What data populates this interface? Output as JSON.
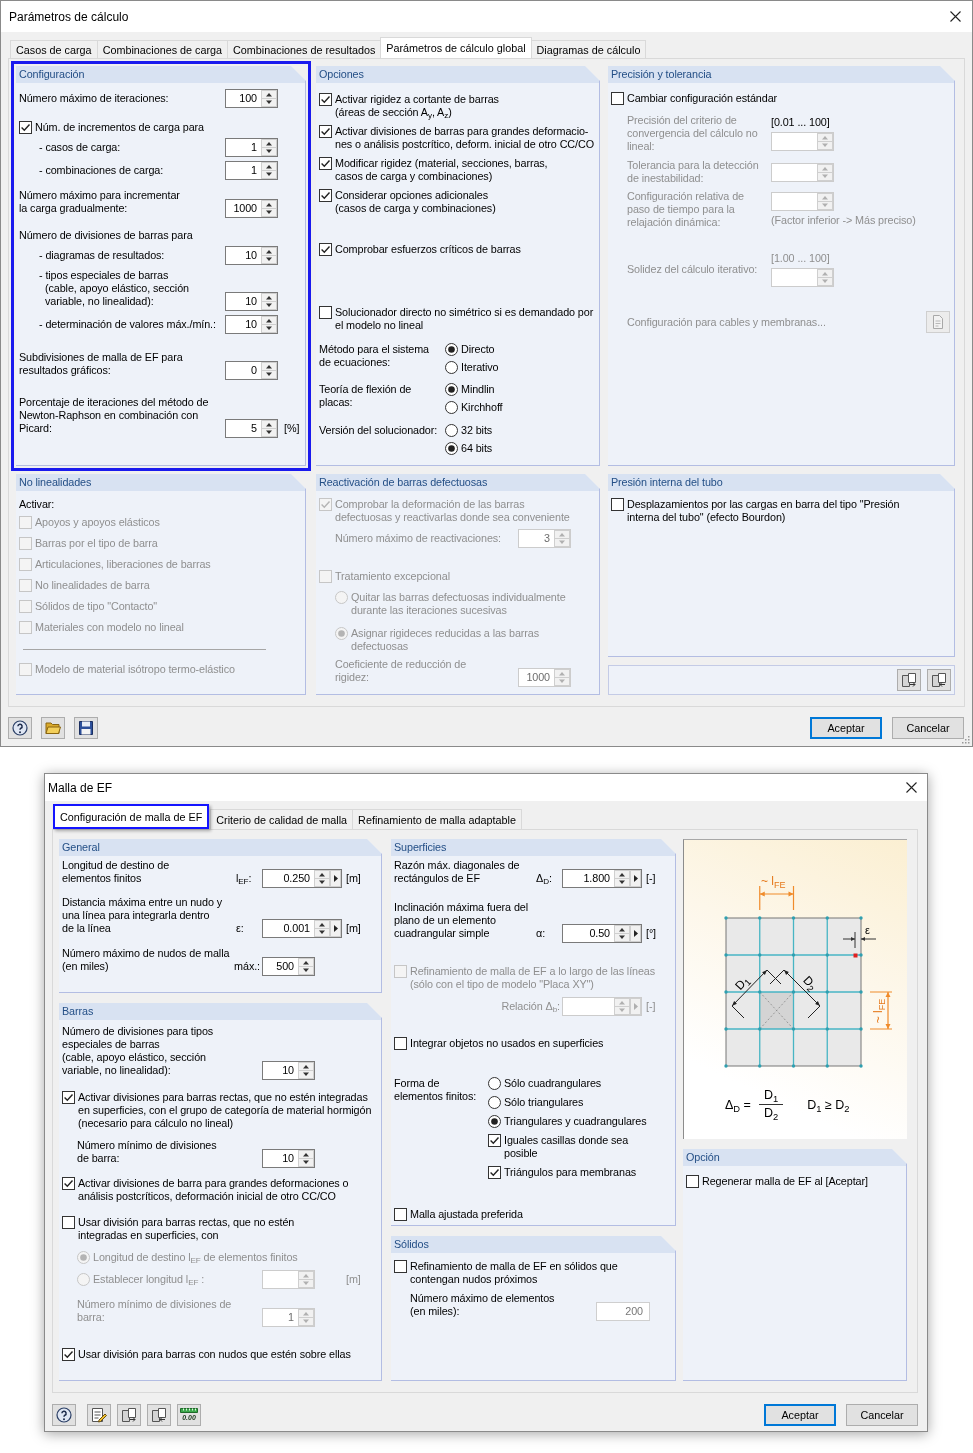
{
  "dialogs": [
    {
      "title": "Parámetros de cálculo",
      "tabs": [
        {
          "label": "Casos de carga",
          "selected": false
        },
        {
          "label": "Combinaciones de carga",
          "selected": false
        },
        {
          "label": "Combinaciones de resultados",
          "selected": false
        },
        {
          "label": "Parámetros de cálculo global",
          "selected": true
        },
        {
          "label": "Diagramas de cálculo",
          "selected": false
        }
      ],
      "columns": [
        {
          "groups": [
            {
              "kind": "panel",
              "title": "Configuración",
              "highlighted": true,
              "items": [
                {
                  "kind": "field",
                  "label": "Número máximo de iteraciones:",
                  "value": "100"
                },
                {
                  "kind": "check",
                  "label": "Núm. de incrementos de carga para",
                  "checked": true,
                  "children": [
                    {
                      "kind": "field",
                      "label": "- casos de carga:",
                      "value": "1"
                    },
                    {
                      "kind": "field",
                      "label": "- combinaciones de carga:",
                      "value": "1"
                    }
                  ]
                },
                {
                  "kind": "field",
                  "label": "Número máximo para incrementar\nla carga gradualmente:",
                  "value": "1000"
                },
                {
                  "kind": "text",
                  "label": "Número de divisiones de barras para",
                  "children": [
                    {
                      "kind": "field",
                      "label": "- diagramas de resultados:",
                      "value": "10"
                    },
                    {
                      "kind": "field",
                      "label": "- tipos especiales de barras\n(cable, apoyo elástico, sección\nvariable, no linealidad):",
                      "value": "10"
                    },
                    {
                      "kind": "field",
                      "label": "- determinación de valores máx./mín.:",
                      "value": "10"
                    }
                  ]
                },
                {
                  "kind": "field",
                  "label": "Subdivisiones de malla de EF para\nresultados gráficos:",
                  "value": "0"
                },
                {
                  "kind": "field",
                  "label": "Porcentaje de iteraciones del método de\nNewton-Raphson en combinación con\nPicard:",
                  "value": "5",
                  "unit": "[%]"
                }
              ]
            },
            {
              "kind": "panel",
              "title": "No linealidades",
              "highlighted": false,
              "items": [
                {
                  "kind": "text",
                  "label": "Activar:"
                },
                {
                  "kind": "check",
                  "label": "Apoyos y apoyos elásticos",
                  "checked": false,
                  "disabled": true
                },
                {
                  "kind": "check",
                  "label": "Barras por el tipo de barra",
                  "checked": false,
                  "disabled": true
                },
                {
                  "kind": "check",
                  "label": "Articulaciones, liberaciones de barras",
                  "checked": false,
                  "disabled": true
                },
                {
                  "kind": "check",
                  "label": "No linealidades de barra",
                  "checked": false,
                  "disabled": true
                },
                {
                  "kind": "check",
                  "label": "Sólidos de tipo \"Contacto\"",
                  "checked": false,
                  "disabled": true
                },
                {
                  "kind": "check",
                  "label": "Materiales con modelo no lineal",
                  "checked": false,
                  "disabled": true
                },
                {
                  "kind": "separator"
                },
                {
                  "kind": "check",
                  "label": "Modelo de material isótropo termo-elástico",
                  "checked": false,
                  "disabled": true
                }
              ]
            }
          ]
        },
        {
          "groups": [
            {
              "kind": "panel",
              "title": "Opciones",
              "highlighted": false,
              "items": [
                {
                  "kind": "check",
                  "label": "Activar rigidez a cortante de barras\n(áreas de sección A$_{y}$, A$_{z}$)",
                  "checked": true
                },
                {
                  "kind": "check",
                  "label": "Activar divisiones de barras para grandes deformacio-\nnes o análisis postcrítico, deform. inicial de otro CC/CO",
                  "checked": true
                },
                {
                  "kind": "check",
                  "label": "Modificar rigidez (material, secciones, barras,\ncasos de carga y combinaciones)",
                  "checked": true
                },
                {
                  "kind": "check",
                  "label": "Considerar opciones adicionales\n(casos de carga y combinaciones)",
                  "checked": true
                },
                {
                  "kind": "check",
                  "label": "Comprobar esfuerzos críticos de barras",
                  "checked": true
                },
                {
                  "kind": "check",
                  "label": "Solucionador directo no simétrico si es demandado por\nel modelo no lineal",
                  "checked": false
                },
                {
                  "kind": "choice",
                  "label": "Método para el sistema\nde ecuaciones:",
                  "options": [
                    {
                      "kind": "radio",
                      "label": "Directo",
                      "selected": true
                    },
                    {
                      "kind": "radio",
                      "label": "Iterativo",
                      "selected": false
                    }
                  ]
                },
                {
                  "kind": "choice",
                  "label": "Teoría de flexión de\nplacas:",
                  "options": [
                    {
                      "kind": "radio",
                      "label": "Mindlin",
                      "selected": true
                    },
                    {
                      "kind": "radio",
                      "label": "Kirchhoff",
                      "selected": false
                    }
                  ]
                },
                {
                  "kind": "choice",
                  "label": "Versión del solucionador:",
                  "options": [
                    {
                      "kind": "radio",
                      "label": "32 bits",
                      "selected": false
                    },
                    {
                      "kind": "radio",
                      "label": "64 bits",
                      "selected": true
                    }
                  ]
                }
              ]
            },
            {
              "kind": "panel",
              "title": "Reactivación de barras defectuosas",
              "highlighted": false,
              "items": [
                {
                  "kind": "check",
                  "label": "Comprobar la deformación de las barras\ndefectuosas y reactivarlas donde sea conveniente",
                  "checked": true,
                  "disabled": true,
                  "children": [
                    {
                      "kind": "field",
                      "label": "Número máximo de reactivaciones:",
                      "value": "3",
                      "disabled": true
                    }
                  ]
                },
                {
                  "kind": "check",
                  "label": "Tratamiento excepcional",
                  "checked": false,
                  "disabled": true,
                  "children": [
                    {
                      "kind": "radio",
                      "label": "Quitar las barras defectuosas individualmente\ndurante las iteraciones sucesivas",
                      "selected": false,
                      "disabled": true
                    },
                    {
                      "kind": "radio",
                      "label": "Asignar rigideces reducidas a las barras\ndefectuosas",
                      "selected": true,
                      "disabled": true
                    },
                    {
                      "kind": "field",
                      "label": "Coeficiente de reducción de\nrigidez:",
                      "value": "1000",
                      "disabled": true
                    }
                  ]
                }
              ]
            }
          ]
        },
        {
          "groups": [
            {
              "kind": "panel",
              "title": "Precisión y tolerancia",
              "highlighted": false,
              "items": [
                {
                  "kind": "check",
                  "label": "Cambiar configuración estándar",
                  "checked": false,
                  "disabled": false,
                  "children": [
                    {
                      "kind": "field",
                      "label": "Precisión del criterio de\nconvergencia del cálculo no\nlineal:",
                      "range": "[0.01 ... 100]",
                      "range_disabled": false,
                      "disabled": true
                    },
                    {
                      "kind": "field",
                      "label": "Tolerancia para la detección\nde inestabilidad:",
                      "disabled": true
                    },
                    {
                      "kind": "field",
                      "label": "Configuración relativa de\npaso de tiempo para la\nrelajación dinámica:",
                      "note": "(Factor inferior -> Más preciso)",
                      "disabled": true
                    },
                    {
                      "kind": "field",
                      "label": "Solidez del cálculo iterativo:",
                      "range": "[1.00 ... 100]",
                      "range_disabled": true,
                      "disabled": true
                    },
                    {
                      "kind": "action",
                      "label": "Configuración para cables y membranas...",
                      "disabled": true
                    }
                  ]
                }
              ]
            },
            {
              "kind": "panel",
              "title": "Presión interna del tubo",
              "highlighted": false,
              "items": [
                {
                  "kind": "check",
                  "label": "Desplazamientos por las cargas en barra del tipo \"Presión\ninterna del tubo\" (efecto Bourdon)",
                  "checked": false
                }
              ]
            },
            {
              "kind": "tools",
              "tools": [
                {
                  "kind": "import"
                },
                {
                  "kind": "export"
                }
              ]
            }
          ]
        }
      ],
      "tools": [
        {
          "kind": "help"
        },
        {
          "kind": "open"
        },
        {
          "kind": "save"
        }
      ],
      "buttons": [
        {
          "label": "Aceptar",
          "default": true
        },
        {
          "label": "Cancelar",
          "default": false
        }
      ]
    },
    {
      "title": "Malla de EF",
      "tabs": [
        {
          "label": "Configuración de malla de EF",
          "selected": true,
          "highlighted": true
        },
        {
          "label": "Criterio de calidad de malla",
          "selected": false,
          "highlighted": false
        },
        {
          "label": "Refinamiento de malla adaptable",
          "selected": false,
          "highlighted": false
        }
      ],
      "columns": [
        {
          "groups": [
            {
              "kind": "panel",
              "title": "General",
              "items": [
                {
                  "kind": "field",
                  "label": "Longitud de destino de\nelementos finitos",
                  "symbol": "l$_{EF}$:",
                  "value": "0.250",
                  "unit": "[m]",
                  "menu_button": true
                },
                {
                  "kind": "field",
                  "label": "Distancia máxima entre un nudo y\nuna línea para integrarla dentro\nde la línea",
                  "symbol": "ε:",
                  "value": "0.001",
                  "unit": "[m]",
                  "menu_button": true
                },
                {
                  "kind": "field",
                  "label": "Número máximo de nudos de malla\n(en miles)",
                  "symbol": "máx.:",
                  "value": "500",
                  "menu_button": false
                }
              ]
            },
            {
              "kind": "panel",
              "title": "Barras",
              "items": [
                {
                  "kind": "field",
                  "label": "Número de divisiones para tipos\nespeciales de barras\n(cable, apoyo elástico, sección\nvariable, no linealidad):",
                  "value": "10",
                  "disabled": false
                },
                {
                  "kind": "check",
                  "label": "Activar divisiones para barras rectas, que no estén integradas\nen superficies, con el grupo de categoría de material hormigón\n(necesario para cálculo no lineal)",
                  "checked": true,
                  "disabled": false,
                  "children": [
                    {
                      "kind": "field",
                      "label": "Número mínimo de divisiones\nde barra:",
                      "value": "10",
                      "disabled": false
                    }
                  ]
                },
                {
                  "kind": "check",
                  "label": "Activar divisiones de barra para grandes deformaciones o\nanálisis postcríticos, deformación inicial de otro CC/CO",
                  "checked": true,
                  "disabled": false
                },
                {
                  "kind": "check",
                  "label": "Usar división para barras rectas, que no estén\nintegradas en superficies, con",
                  "checked": false,
                  "disabled": false,
                  "children": [
                    {
                      "kind": "radio",
                      "label": "Longitud de destino l$_{EF}$ de elementos finitos",
                      "selected": true,
                      "disabled": true
                    },
                    {
                      "kind": "radio_field",
                      "label": "Establecer longitud l$_{EF}$ :",
                      "selected": false,
                      "disabled": true,
                      "unit": "[m]"
                    },
                    {
                      "kind": "field",
                      "label": "Número mínimo de divisiones de\nbarra:",
                      "value": "1",
                      "disabled": true
                    }
                  ]
                },
                {
                  "kind": "check",
                  "label": "Usar división para barras con nudos que estén sobre ellas",
                  "checked": true,
                  "disabled": false
                }
              ]
            }
          ]
        },
        {
          "groups": [
            {
              "kind": "panel",
              "title": "Superficies",
              "items": [
                {
                  "kind": "field",
                  "label": "Razón máx. diagonales de\nrectángulos de EF",
                  "symbol": "Δ$_{D}$:",
                  "value": "1.800",
                  "unit": "[-]",
                  "menu_button": true,
                  "disabled": false
                },
                {
                  "kind": "field",
                  "label": "Inclinación máxima fuera del\nplano de un elemento\ncuadrangular simple",
                  "symbol": "α:",
                  "value": "0.50",
                  "unit": "[°]",
                  "menu_button": true,
                  "disabled": false
                },
                {
                  "kind": "check",
                  "label": "Refinamiento de malla de EF a lo largo de las líneas\n(sólo con el tipo de modelo \"Placa XY\")",
                  "checked": false,
                  "disabled": true,
                  "children": [
                    {
                      "kind": "field",
                      "symbol": "Relación Δ$_{b}$:",
                      "unit": "[-]",
                      "menu_button": true,
                      "disabled": true
                    }
                  ]
                },
                {
                  "kind": "check",
                  "label": "Integrar objetos no usados en superficies",
                  "checked": false,
                  "disabled": false
                },
                {
                  "kind": "choice",
                  "label": "Forma de\nelementos finitos:",
                  "options": [
                    {
                      "kind": "radio",
                      "label": "Sólo cuadrangulares",
                      "selected": false
                    },
                    {
                      "kind": "radio",
                      "label": "Sólo triangulares",
                      "selected": false
                    },
                    {
                      "kind": "radio",
                      "label": "Triangulares y cuadrangulares",
                      "selected": true
                    },
                    {
                      "kind": "check",
                      "label": "Iguales casillas donde sea\nposible",
                      "checked": true
                    },
                    {
                      "kind": "check",
                      "label": "Triángulos para membranas",
                      "checked": true
                    }
                  ]
                },
                {
                  "kind": "check",
                  "label": "Malla ajustada preferida",
                  "checked": false,
                  "disabled": false
                }
              ]
            },
            {
              "kind": "panel",
              "title": "Sólidos",
              "items": [
                {
                  "kind": "check",
                  "label": "Refinamiento de malla de EF en sólidos que\ncontengan nudos próximos",
                  "checked": false,
                  "children": [
                    {
                      "kind": "field",
                      "label": "Número máximo de elementos\n(en miles):",
                      "value": "200",
                      "readonly": true
                    }
                  ]
                }
              ]
            }
          ]
        },
        {
          "groups": [
            {
              "kind": "illustration",
              "labels": {
                "top_dimension": "~ l$_{FE}$",
                "side_dimension": "~ l$_{FE}$",
                "tolerance": "ε",
                "diagonal_1": "D$_{1}$",
                "diagonal_2": "D$_{2}$"
              },
              "formula": {
                "lhs": "Δ$_{D}$ =",
                "numerator": "D$_{1}$",
                "denominator": "D$_{2}$",
                "condition": "D$_{1}$ ≥ D$_{2}$"
              }
            },
            {
              "kind": "panel",
              "title": "Opción",
              "items": [
                {
                  "kind": "check",
                  "label": "Regenerar malla de EF al [Aceptar]",
                  "checked": false
                }
              ]
            }
          ]
        }
      ],
      "tools": [
        {
          "kind": "help"
        },
        {
          "kind": "edit"
        },
        {
          "kind": "import"
        },
        {
          "kind": "export"
        },
        {
          "kind": "decimals",
          "text": "0.00"
        }
      ],
      "buttons": [
        {
          "label": "Aceptar",
          "default": true
        },
        {
          "label": "Cancelar",
          "default": false
        }
      ]
    }
  ]
}
